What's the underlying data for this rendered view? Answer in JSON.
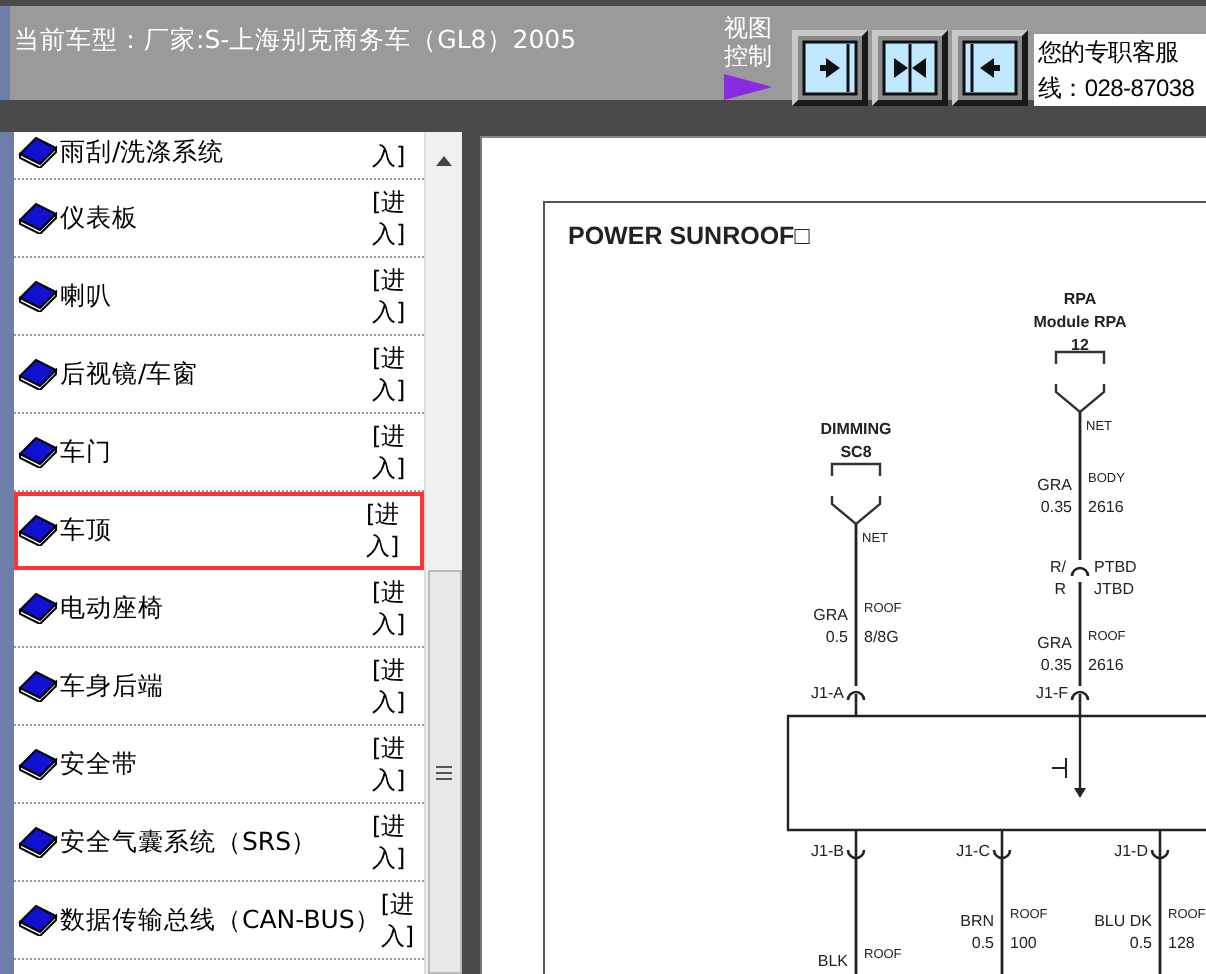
{
  "header": {
    "vehicle": "当前车型：厂家:S-上海别克商务车（GL8）2005",
    "view_control": "视图控制",
    "view_buttons": [
      {
        "kind": "right"
      },
      {
        "kind": "both"
      },
      {
        "kind": "left"
      }
    ],
    "service_lines": [
      "您的专职客服",
      "线：028-87038"
    ]
  },
  "sidebar": {
    "items": [
      {
        "title": "雨刮/洗涤系统",
        "link": "入]",
        "selected": false
      },
      {
        "title": "仪表板",
        "link": "[进入]",
        "selected": false
      },
      {
        "title": "喇叭",
        "link": "[进入]",
        "selected": false
      },
      {
        "title": "后视镜/车窗",
        "link": "[进入]",
        "selected": false
      },
      {
        "title": "车门",
        "link": "[进入]",
        "selected": false
      },
      {
        "title": "车顶",
        "link": "[进入]",
        "selected": true
      },
      {
        "title": "电动座椅",
        "link": "[进入]",
        "selected": false
      },
      {
        "title": "车身后端",
        "link": "[进入]",
        "selected": false
      },
      {
        "title": "安全带",
        "link": "[进入]",
        "selected": false
      },
      {
        "title": "安全气囊系统（SRS）",
        "link": "[进入]",
        "selected": false
      },
      {
        "title": "数据传输总线（CAN-BUS）",
        "link": "[进入]",
        "selected": false
      }
    ]
  },
  "diagram": {
    "title": "POWER SUNROOF□",
    "components": [
      {
        "label_lines": [
          "RPA",
          "Module RPA",
          "12"
        ],
        "net": "NET"
      },
      {
        "label_lines": [
          "DIMMING",
          "SC8"
        ],
        "net": "NET"
      }
    ],
    "inline_connector": [
      "R/",
      "R",
      "PTBD",
      "JTBD"
    ],
    "pins": [
      "J1-A",
      "J1-F",
      "J1-B",
      "J1-C",
      "J1-D"
    ],
    "wires": [
      {
        "wire_color": "GRA",
        "size": "0.35",
        "location": "BODY",
        "circuit": "2616"
      },
      {
        "wire_color": "GRA",
        "size": "0.5",
        "location": "ROOF",
        "circuit": "8/8G"
      },
      {
        "wire_color": "GRA",
        "size": "0.35",
        "location": "ROOF",
        "circuit": "2616"
      },
      {
        "wire_color": "BRN",
        "size": "0.5",
        "location": "ROOF",
        "circuit": "100"
      },
      {
        "wire_color": "BLU DK",
        "size": "0.5",
        "location": "ROOF",
        "circuit": "128"
      },
      {
        "wire_color": "BLK",
        "location": "ROOF"
      }
    ]
  }
}
